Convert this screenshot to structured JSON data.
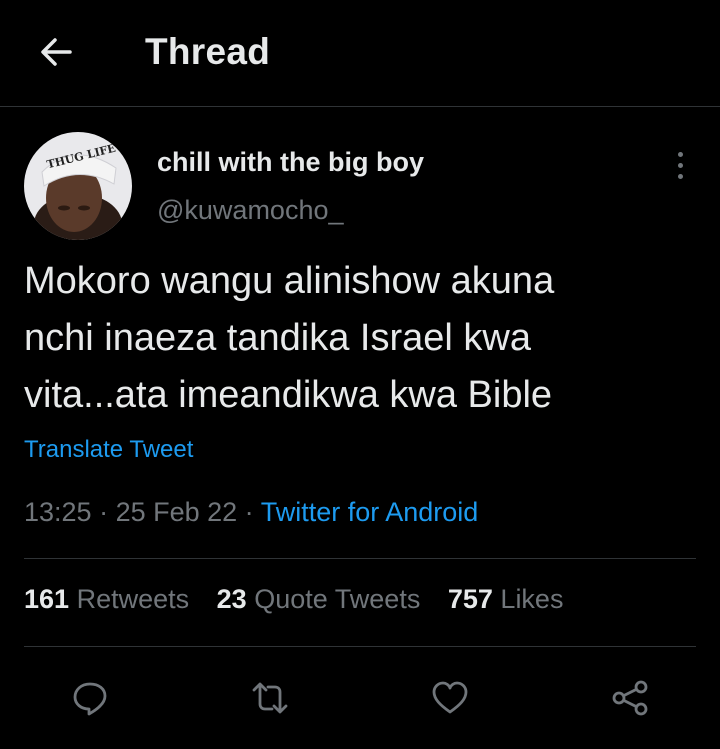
{
  "header": {
    "title": "Thread"
  },
  "author": {
    "name": "chill with the big boy",
    "handle": "@kuwamocho_",
    "avatar_caption": "THUG LIFE"
  },
  "tweet": {
    "lines": [
      "Mokoro wangu alinishow akuna",
      "nchi inaeza tandika Israel kwa",
      "vita...ata imeandikwa kwa Bible"
    ],
    "translate_label": "Translate Tweet"
  },
  "meta": {
    "time": "13:25",
    "sep1": " · ",
    "date": "25 Feb 22",
    "sep2": " · ",
    "source": "Twitter for Android"
  },
  "stats": {
    "retweets_count": "161",
    "retweets_label": "Retweets",
    "quotes_count": "23",
    "quotes_label": "Quote Tweets",
    "likes_count": "757",
    "likes_label": "Likes"
  },
  "actions": [
    "reply-icon",
    "retweet-icon",
    "like-icon",
    "share-icon"
  ],
  "colors": {
    "background": "#000000",
    "text": "#e7e9ea",
    "muted": "#71767b",
    "accent": "#1d9bf0",
    "divider": "#2f3336"
  }
}
